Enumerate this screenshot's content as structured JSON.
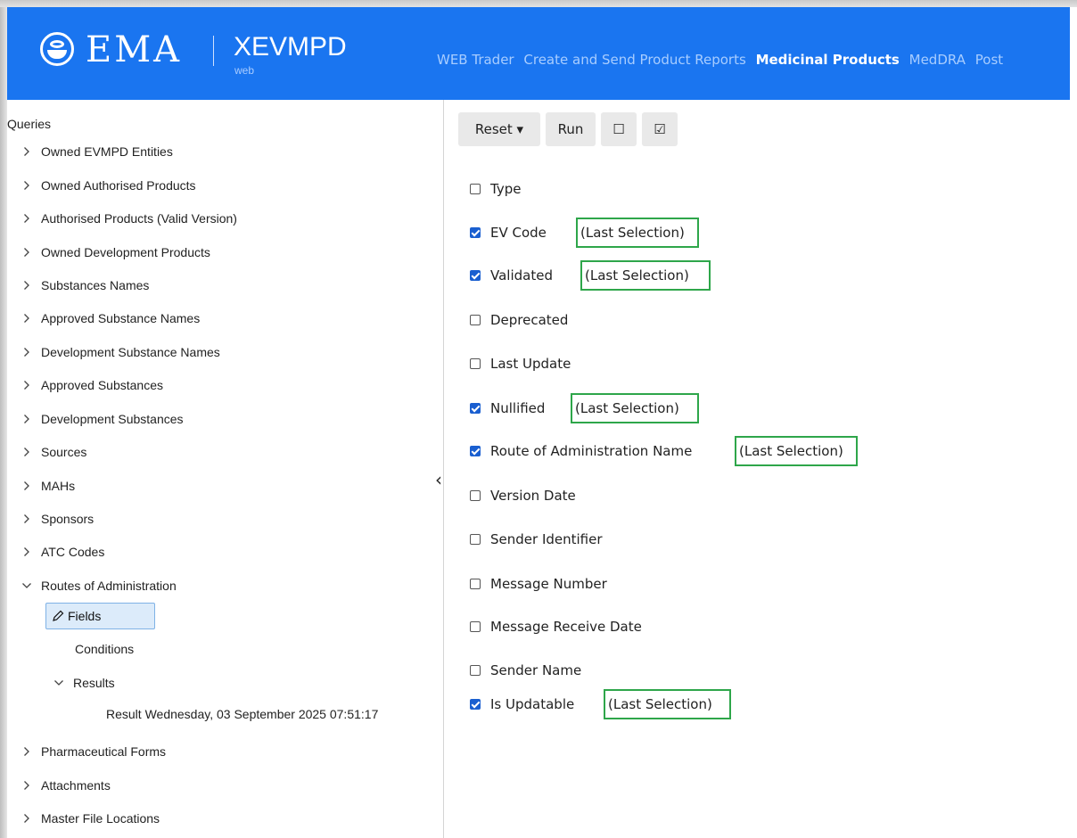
{
  "header": {
    "brand": "EMA",
    "product": "XEVMPD",
    "product_sub": "web",
    "nav": [
      "WEB Trader",
      "Create and Send Product Reports",
      "Medicinal Products",
      "MedDRA",
      "Post"
    ],
    "active_nav": "Medicinal Products",
    "color": "#1a75f0"
  },
  "sidebar": {
    "title": "Queries",
    "items": [
      "Owned EVMPD Entities",
      "Owned Authorised Products",
      "Authorised Products (Valid Version)",
      "Owned Development Products",
      "Substances Names",
      "Approved Substance Names",
      "Development Substance Names",
      "Approved Substances",
      "Development Substances",
      "Sources",
      "MAHs",
      "Sponsors",
      "ATC Codes",
      "Routes of Administration"
    ],
    "expanded": {
      "fields": "Fields",
      "conditions": "Conditions",
      "results": "Results",
      "result_entry": "Result Wednesday, 03 September 2025 07:51:17"
    },
    "items_after": [
      "Pharmaceutical Forms",
      "Attachments",
      "Master File Locations"
    ]
  },
  "toolbar": {
    "reset": "Reset ▾",
    "run": "Run",
    "check_none": "☐",
    "check_all": "☑"
  },
  "fields": [
    {
      "label": "Type",
      "checked": false,
      "last_selection": false
    },
    {
      "label": "EV Code",
      "checked": true,
      "last_selection": true
    },
    {
      "label": "Validated",
      "checked": true,
      "last_selection": true
    },
    {
      "label": "Deprecated",
      "checked": false,
      "last_selection": false
    },
    {
      "label": "Last Update",
      "checked": false,
      "last_selection": false
    },
    {
      "label": "Nullified",
      "checked": true,
      "last_selection": true
    },
    {
      "label": "Route of Administration Name",
      "checked": true,
      "last_selection": true
    },
    {
      "label": "Version Date",
      "checked": false,
      "last_selection": false
    },
    {
      "label": "Sender Identifier",
      "checked": false,
      "last_selection": false
    },
    {
      "label": "Message Number",
      "checked": false,
      "last_selection": false
    },
    {
      "label": "Message Receive Date",
      "checked": false,
      "last_selection": false
    },
    {
      "label": "Sender Name",
      "checked": false,
      "last_selection": false
    },
    {
      "label": "Is Updatable",
      "checked": true,
      "last_selection": true
    }
  ],
  "last_selection_label": "(Last Selection)",
  "collapse_glyph": "‹"
}
